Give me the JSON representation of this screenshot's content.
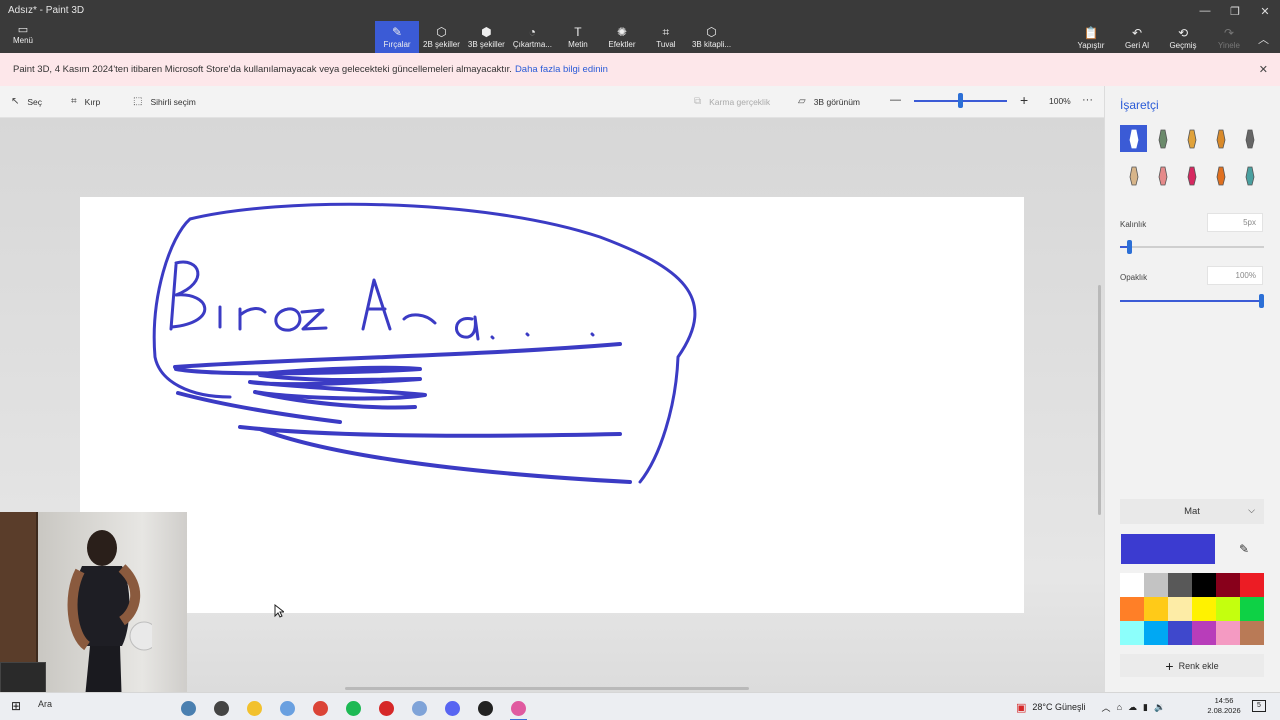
{
  "window": {
    "title": "Adsız* - Paint 3D",
    "minimize_icon": "minimize-icon",
    "restore_icon": "restore-icon",
    "close_icon": "close-icon"
  },
  "ribbon": {
    "menu_label": "Menü",
    "tools": [
      {
        "label": "Fırçalar",
        "icon": "brush-icon",
        "active": true
      },
      {
        "label": "2B şekiller",
        "icon": "shapes-2d-icon"
      },
      {
        "label": "3B şekiller",
        "icon": "shapes-3d-icon"
      },
      {
        "label": "Çıkartma...",
        "icon": "sticker-icon"
      },
      {
        "label": "Metin",
        "icon": "text-icon"
      },
      {
        "label": "Efektler",
        "icon": "effects-icon"
      },
      {
        "label": "Tuval",
        "icon": "canvas-icon"
      },
      {
        "label": "3B kitapli...",
        "icon": "library-icon"
      }
    ],
    "actions": [
      {
        "label": "Yapıştır",
        "icon": "paste-icon"
      },
      {
        "label": "Geri Al",
        "icon": "undo-icon"
      },
      {
        "label": "Geçmiş",
        "icon": "history-icon"
      },
      {
        "label": "Yinele",
        "icon": "redo-icon",
        "disabled": true
      }
    ]
  },
  "notice": {
    "text": "Paint 3D, 4 Kasım 2024'ten itibaren Microsoft Store'da kullanılamayacak veya gelecekteki güncellemeleri almayacaktır.",
    "link": "Daha fazla bilgi edinin"
  },
  "subbar": {
    "select": "Seç",
    "crop": "Kırp",
    "magic_select": "Sihirli seçim",
    "mixed_reality": "Karma gerçeklik",
    "view_3d": "3B görünüm",
    "zoom_minus": "—",
    "zoom_plus": "+",
    "zoom_level": "100%",
    "zoom_fraction": 0.47,
    "more": "···"
  },
  "canvas": {
    "drawing_text": "Biroz Ara...",
    "stroke_color": "#3b3bc4"
  },
  "panel": {
    "title": "İşaretçi",
    "brushes": [
      {
        "name": "marker-brush-icon",
        "active": true
      },
      {
        "name": "calligraphy-pen-icon"
      },
      {
        "name": "oil-brush-icon"
      },
      {
        "name": "watercolor-icon"
      },
      {
        "name": "pixel-pen-icon"
      },
      {
        "name": "pencil-icon"
      },
      {
        "name": "eraser-icon"
      },
      {
        "name": "crayon-icon"
      },
      {
        "name": "spray-can-icon"
      },
      {
        "name": "fill-bucket-icon"
      }
    ],
    "thickness_label": "Kalınlık",
    "thickness_value": "5px",
    "thickness_fraction": 0.05,
    "opacity_label": "Opaklık",
    "opacity_value": "100%",
    "opacity_fraction": 1.0,
    "finish": "Mat",
    "current_color": "#3b3bd0",
    "add_color": "Renk ekle",
    "palette": [
      "#ffffff",
      "#c3c3c3",
      "#585858",
      "#000000",
      "#88001b",
      "#ec1c24",
      "#ff7f27",
      "#ffca18",
      "#fdeca6",
      "#fff200",
      "#c4ff0e",
      "#0ed145",
      "#8cfffb",
      "#00a8f3",
      "#3f48cc",
      "#b83dba",
      "#f49ac2",
      "#b97a56"
    ]
  },
  "taskbar": {
    "search": "Ara",
    "apps": [
      {
        "name": "weather-widget-icon",
        "color": "#4a7fb0"
      },
      {
        "name": "task-view-icon",
        "color": "#444444"
      },
      {
        "name": "file-explorer-icon",
        "color": "#f2c12e"
      },
      {
        "name": "snipping-tool-icon",
        "color": "#6aa0e0"
      },
      {
        "name": "chrome-icon",
        "color": "#db4437"
      },
      {
        "name": "spotify-icon",
        "color": "#1db954"
      },
      {
        "name": "app-red-icon",
        "color": "#d62828"
      },
      {
        "name": "settings-app-icon",
        "color": "#7fa3d8"
      },
      {
        "name": "discord-icon",
        "color": "#5865f2"
      },
      {
        "name": "obs-icon",
        "color": "#222222"
      },
      {
        "name": "paint3d-icon",
        "color": "#e05aa0",
        "active": true
      }
    ],
    "weather": "28°C  Güneşli",
    "time": "14:56",
    "date": "2.08.2026",
    "notification_count": "5"
  }
}
